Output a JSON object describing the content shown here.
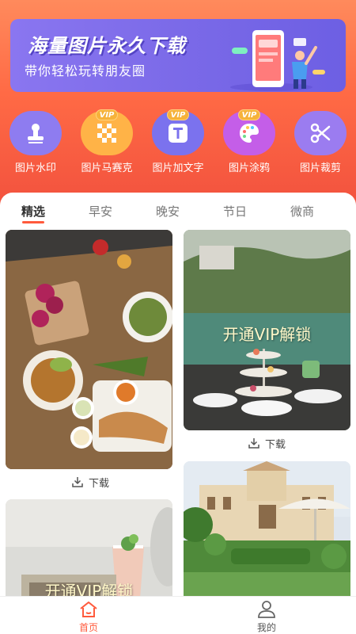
{
  "banner": {
    "title": "海量图片永久下载",
    "subtitle": "带你轻松玩转朋友圈"
  },
  "tools": [
    {
      "label": "图片水印",
      "icon": "stamp-icon",
      "color": "#8e7cf0",
      "vip": ""
    },
    {
      "label": "图片马赛克",
      "icon": "mosaic-icon",
      "color": "#ffb347",
      "vip": "VIP"
    },
    {
      "label": "图片加文字",
      "icon": "text-icon",
      "color": "#7b72ee",
      "vip": "VIP"
    },
    {
      "label": "图片涂鸦",
      "icon": "palette-icon",
      "color": "#c45ee8",
      "vip": "VIP"
    },
    {
      "label": "图片裁剪",
      "icon": "scissors-icon",
      "color": "#9b7cf0",
      "vip": ""
    }
  ],
  "tabs": [
    "精选",
    "早安",
    "晚安",
    "节日",
    "微商"
  ],
  "cards": {
    "unlock_text": "开通VIP解锁",
    "download_label": "下载"
  },
  "nav": {
    "home": "首页",
    "mine": "我的"
  },
  "colors": {
    "accent": "#ff5a3c",
    "banner": "#7b6ae8",
    "vip": "#f6b23a"
  }
}
